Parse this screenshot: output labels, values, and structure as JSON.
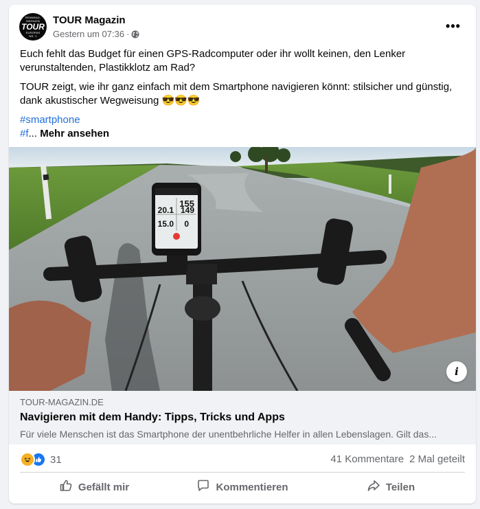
{
  "post": {
    "page_name": "TOUR Magazin",
    "avatar": {
      "line1": "RENNRAD-",
      "line2": "MAGAZIN",
      "brand": "TOUR",
      "line3": "EUROPAS",
      "line4": "NR. 1"
    },
    "timestamp": "Gestern um 07:36",
    "separator": "·",
    "audience_icon": "globe-icon",
    "more_icon": "•••",
    "text": {
      "para1": "Euch fehlt das Budget für einen GPS-Radcomputer oder ihr wollt keinen, den Lenker verunstaltenden, Plastikklotz am Rad?",
      "para2": "TOUR zeigt, wie ihr ganz einfach mit dem Smartphone navigieren könnt:  stilsicher und günstig, dank akustischer Wegweisung 😎😎😎",
      "hashtag1": "#smartphone",
      "hashtag2_trunc": "#f",
      "ellipsis": "...",
      "more_label": "Mehr ansehen"
    }
  },
  "image": {
    "phone_readout": [
      "155",
      "20.1",
      "149",
      "15.0",
      "0"
    ],
    "info_label": "i"
  },
  "link_preview": {
    "domain": "TOUR-MAGAZIN.DE",
    "title": "Navigieren mit dem Handy: Tipps, Tricks und Apps",
    "description": "Für viele Menschen ist das Smartphone der unentbehrliche Helfer in allen Lebenslagen. Gilt das..."
  },
  "stats": {
    "reaction_count": "31",
    "comments": "41 Kommentare",
    "shares": "2 Mal geteilt",
    "reaction_icons": [
      "haha-icon",
      "like-icon"
    ]
  },
  "actions": {
    "like": "Gefällt mir",
    "comment": "Kommentieren",
    "share": "Teilen"
  },
  "colors": {
    "background": "#f0f2f5",
    "card": "#ffffff",
    "hashtag": "#216fdb",
    "secondary_text": "#65676b",
    "like_blue": "#1877f2",
    "haha_yellow": "#f7b125"
  }
}
